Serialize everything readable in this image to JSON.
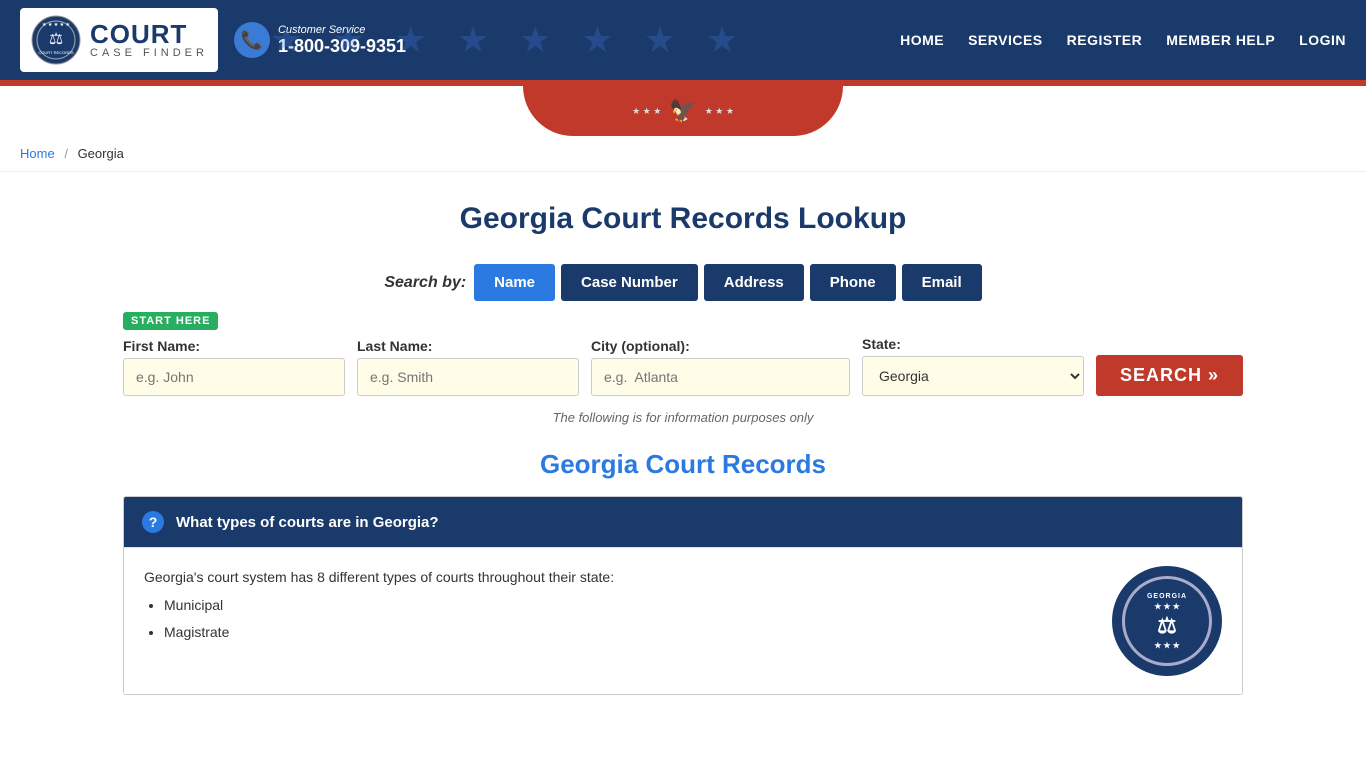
{
  "header": {
    "logo": {
      "court_text": "COURT",
      "case_finder_text": "CASE FINDER"
    },
    "customer_service": {
      "label": "Customer Service",
      "phone": "1-800-309-9351"
    },
    "nav": [
      {
        "label": "HOME",
        "href": "#"
      },
      {
        "label": "SERVICES",
        "href": "#"
      },
      {
        "label": "REGISTER",
        "href": "#"
      },
      {
        "label": "MEMBER HELP",
        "href": "#"
      },
      {
        "label": "LOGIN",
        "href": "#"
      }
    ]
  },
  "breadcrumb": {
    "home_label": "Home",
    "current": "Georgia"
  },
  "main": {
    "page_title": "Georgia Court Records Lookup",
    "search": {
      "by_label": "Search by:",
      "tabs": [
        {
          "label": "Name",
          "active": true
        },
        {
          "label": "Case Number",
          "active": false
        },
        {
          "label": "Address",
          "active": false
        },
        {
          "label": "Phone",
          "active": false
        },
        {
          "label": "Email",
          "active": false
        }
      ],
      "start_here_badge": "START HERE",
      "fields": {
        "first_name": {
          "label": "First Name:",
          "placeholder": "e.g. John"
        },
        "last_name": {
          "label": "Last Name:",
          "placeholder": "e.g. Smith"
        },
        "city": {
          "label": "City (optional):",
          "placeholder": "e.g.  Atlanta"
        },
        "state": {
          "label": "State:",
          "default": "Georgia"
        }
      },
      "search_button": "SEARCH »",
      "info_note": "The following is for information purposes only"
    },
    "section_title": "Georgia Court Records",
    "faq": [
      {
        "question": "What types of courts are in Georgia?",
        "body_intro": "Georgia's court system has 8 different types of courts throughout their state:",
        "list_items": [
          "Municipal",
          "Magistrate"
        ]
      }
    ]
  }
}
